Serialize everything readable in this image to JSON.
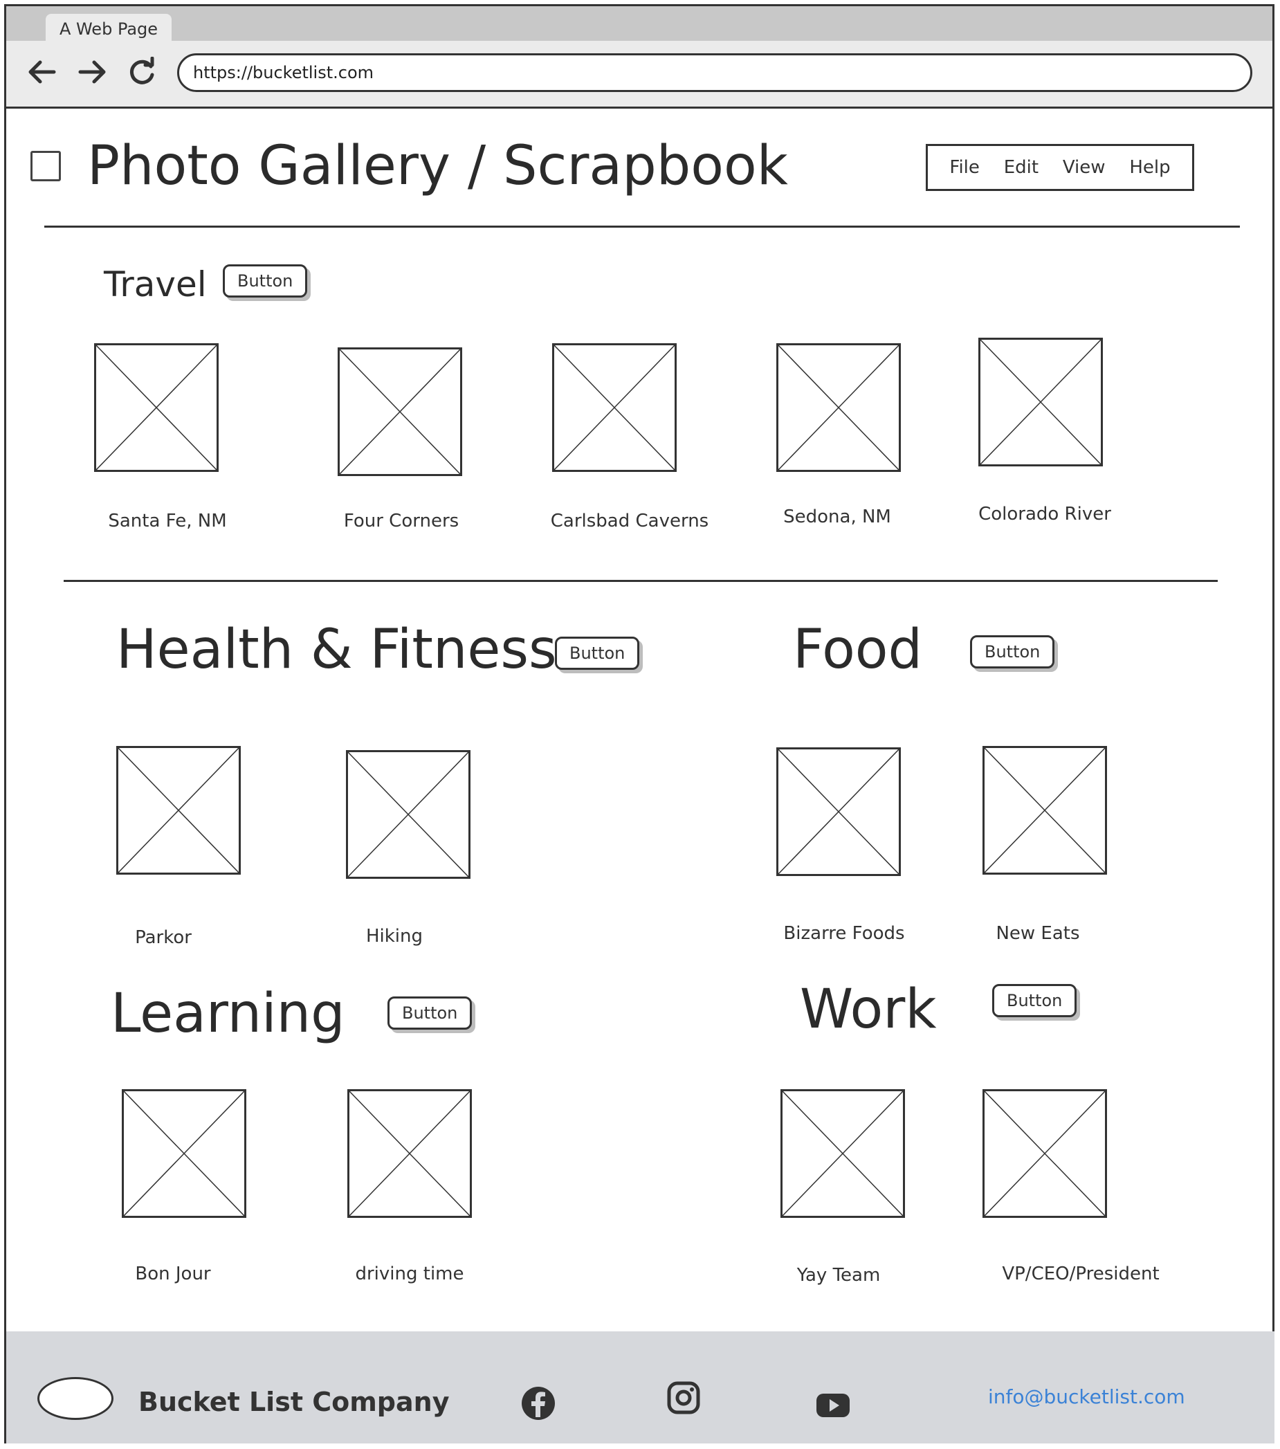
{
  "browser": {
    "tab_title": "A Web Page",
    "back_icon": "arrow-left-icon",
    "forward_icon": "arrow-right-icon",
    "reload_icon": "reload-icon",
    "url": "https://bucketlist.com"
  },
  "header": {
    "title": "Photo Gallery / Scrapbook",
    "menu": [
      "File",
      "Edit",
      "View",
      "Help"
    ]
  },
  "sections": {
    "travel": {
      "title": "Travel",
      "button": "Button",
      "items": [
        "Santa Fe, NM",
        "Four Corners",
        "Carlsbad Caverns",
        "Sedona, NM",
        "Colorado River"
      ]
    },
    "health": {
      "title": "Health & Fitness",
      "button": "Button",
      "items": [
        "Parkor",
        "Hiking"
      ]
    },
    "food": {
      "title": "Food",
      "button": "Button",
      "items": [
        "Bizarre Foods",
        "New Eats"
      ]
    },
    "learning": {
      "title": "Learning",
      "button": "Button",
      "items": [
        "Bon Jour",
        "driving time"
      ]
    },
    "work": {
      "title": "Work",
      "button": "Button",
      "items": [
        "Yay Team",
        "VP/CEO/President"
      ]
    }
  },
  "footer": {
    "company": "Bucket List Company",
    "social_icons": [
      "facebook-icon",
      "instagram-icon",
      "youtube-icon"
    ],
    "email": "info@bucketlist.com",
    "email_color": "#3b82d6"
  }
}
